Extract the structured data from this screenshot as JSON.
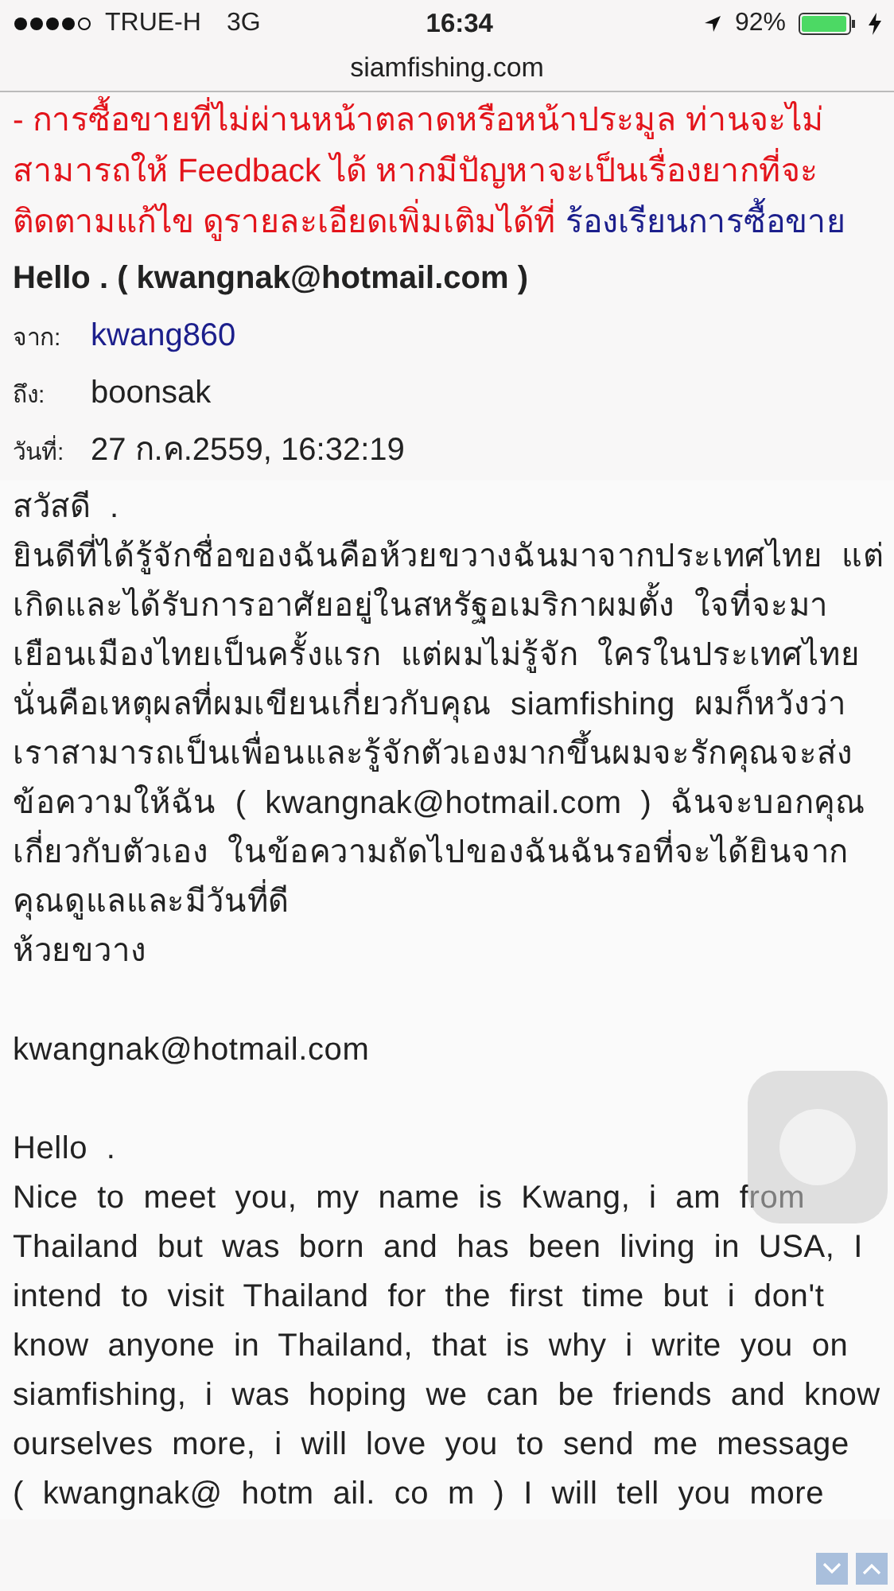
{
  "status_bar": {
    "carrier": "TRUE-H",
    "network": "3G",
    "time": "16:34",
    "battery_percent": "92%"
  },
  "address_bar": {
    "url": "siamfishing.com"
  },
  "notice": {
    "text": "- การซื้อขายที่ไม่ผ่านหน้าตลาดหรือหน้าประมูล ท่านจะไม่สามารถให้ Feedback ได้ หากมีปัญหาจะเป็นเรื่องยากที่จะติดตามแก้ไข ดูรายละเอียดเพิ่มเติมได้ที่",
    "link": "ร้องเรียนการซื้อขาย"
  },
  "message": {
    "subject": "Hello . ( kwangnak@hotmail.com )",
    "fields": [
      {
        "label": "จาก:",
        "value": "kwang860",
        "kind": "link"
      },
      {
        "label": "ถึง:",
        "value": "boonsak",
        "kind": "text"
      },
      {
        "label": "วันที่:",
        "value": "27 ก.ค.2559, 16:32:19",
        "kind": "text"
      }
    ],
    "body": [
      {
        "kind": "line",
        "text": "สวัสดี ."
      },
      {
        "kind": "line",
        "text": "ยินดีที่ได้รู้จักชื่อของฉันคือห้วยขวางฉันมาจากประเทศไทย แต่เกิดและได้รับการอาศัยอยู่ในสหรัฐอเมริกาผมตั้ง ใจที่จะมาเยือนเมืองไทยเป็นครั้งแรก แต่ผมไม่รู้จัก ใครในประเทศไทยนั่นคือเหตุผลที่ผมเขียนเกี่ยวกับคุณ siamfishing ผมก็หวังว่าเราสามารถเป็นเพื่อนและรู้จักตัวเองมากขึ้นผมจะรักคุณจะส่งข้อความให้ฉัน ( kwangnak@hotmail.com ) ฉันจะบอกคุณเกี่ยวกับตัวเอง ในข้อความถัดไปของฉันฉันรอที่จะได้ยินจากคุณดูแลและมีวันที่ดี"
      },
      {
        "kind": "line",
        "text": "ห้วยขวาง"
      },
      {
        "kind": "spacer"
      },
      {
        "kind": "line",
        "text": "kwangnak@hotmail.com"
      },
      {
        "kind": "spacer"
      },
      {
        "kind": "line",
        "text": "Hello ."
      },
      {
        "kind": "line",
        "text": "Nice to meet you, my name is Kwang, i am from Thailand but was born and has been living in USA, I intend to visit Thailand for the first time but i don't know anyone in Thailand, that is why i write you on siamfishing, i was hoping we can be friends and know ourselves more, i will love you to send me message"
      },
      {
        "kind": "line",
        "text": "( kwangnak@ hotm ail. co m ) I will tell you more"
      }
    ]
  }
}
